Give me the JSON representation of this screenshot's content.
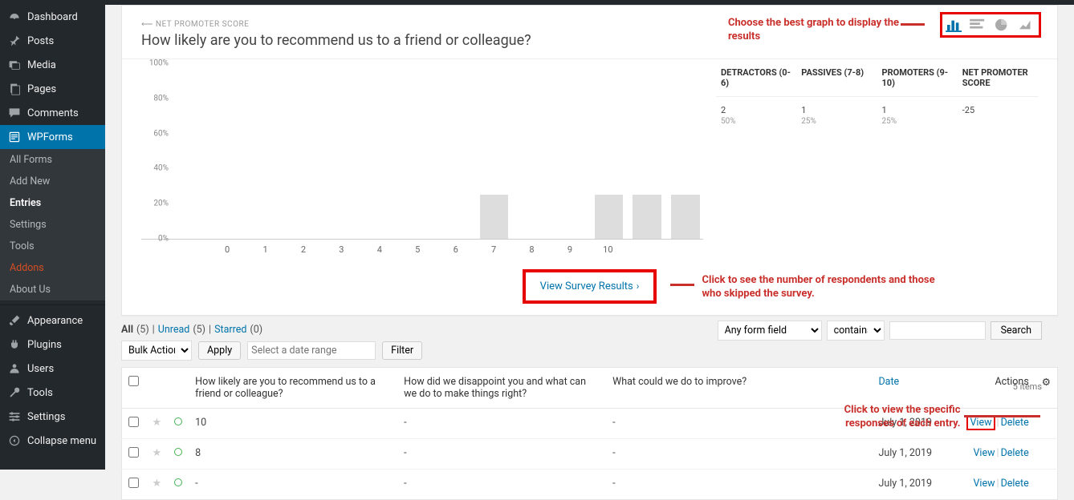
{
  "sidebar": {
    "dashboard": "Dashboard",
    "posts": "Posts",
    "media": "Media",
    "pages": "Pages",
    "comments": "Comments",
    "wpforms": "WPForms",
    "sub_all": "All Forms",
    "sub_add": "Add New",
    "sub_entries": "Entries",
    "sub_settings": "Settings",
    "sub_tools": "Tools",
    "sub_addons": "Addons",
    "sub_about": "About Us",
    "appearance": "Appearance",
    "plugins": "Plugins",
    "users": "Users",
    "tools": "Tools",
    "settings": "Settings",
    "collapse": "Collapse menu"
  },
  "card": {
    "crumb": "NET PROMOTER SCORE",
    "question": "How likely are you to recommend us to a friend or colleague?",
    "anno1": "Choose the best graph to display the results",
    "vsr": "View Survey Results",
    "anno2": "Click to see the number of respondents and those who skipped the survey.",
    "nps_head_det": "DETRACTORS (0-6)",
    "nps_head_pas": "PASSIVES (7-8)",
    "nps_head_pro": "PROMOTERS (9-10)",
    "nps_head_score": "NET PROMOTER SCORE",
    "nps_det_v": "2",
    "nps_det_p": "50%",
    "nps_pas_v": "1",
    "nps_pas_p": "25%",
    "nps_pro_v": "1",
    "nps_pro_p": "25%",
    "nps_score": "-25"
  },
  "chart_data": {
    "type": "bar",
    "title": "How likely are you to recommend us to a friend or colleague?",
    "xlabel": "",
    "ylabel": "",
    "ylim": [
      0,
      100
    ],
    "yticks": [
      0,
      20,
      40,
      60,
      80,
      100
    ],
    "categories": [
      "0",
      "1",
      "2",
      "3",
      "4",
      "5",
      "6",
      "7",
      "8",
      "9",
      "10"
    ],
    "values": [
      0,
      0,
      0,
      0,
      0,
      0,
      0,
      0,
      25,
      0,
      0,
      25,
      25,
      25
    ],
    "note": "bar indices map to the visible 14 slots; labeled integers 0-10 sit on slots 1-11; bars at slots 8,11,12,13"
  },
  "list": {
    "tab_all": "All",
    "cnt_all": "(5)",
    "pipe": "|",
    "tab_unread": "Unread",
    "cnt_unread": "(5)",
    "tab_star": "Starred",
    "cnt_star": "(0)",
    "bulk": "Bulk Actions",
    "apply": "Apply",
    "date_ph": "Select a date range",
    "filter": "Filter",
    "anyfield": "Any form field",
    "contains": "contains",
    "search": "Search",
    "items": "5 items",
    "col_q1": "How likely are you to recommend us to a friend or colleague?",
    "col_q2": "How did we disappoint you and what can we do to make things right?",
    "col_q3": "What could we do to improve?",
    "col_date": "Date",
    "col_act": "Actions",
    "anno3": "Click to view the specific responses of each entry.",
    "rows": [
      {
        "v": "10",
        "d": "July 1, 2019"
      },
      {
        "v": "8",
        "d": "July 1, 2019"
      },
      {
        "v": "-",
        "d": "July 1, 2019"
      }
    ],
    "dash": "-",
    "view": "View",
    "delete": "Delete"
  }
}
